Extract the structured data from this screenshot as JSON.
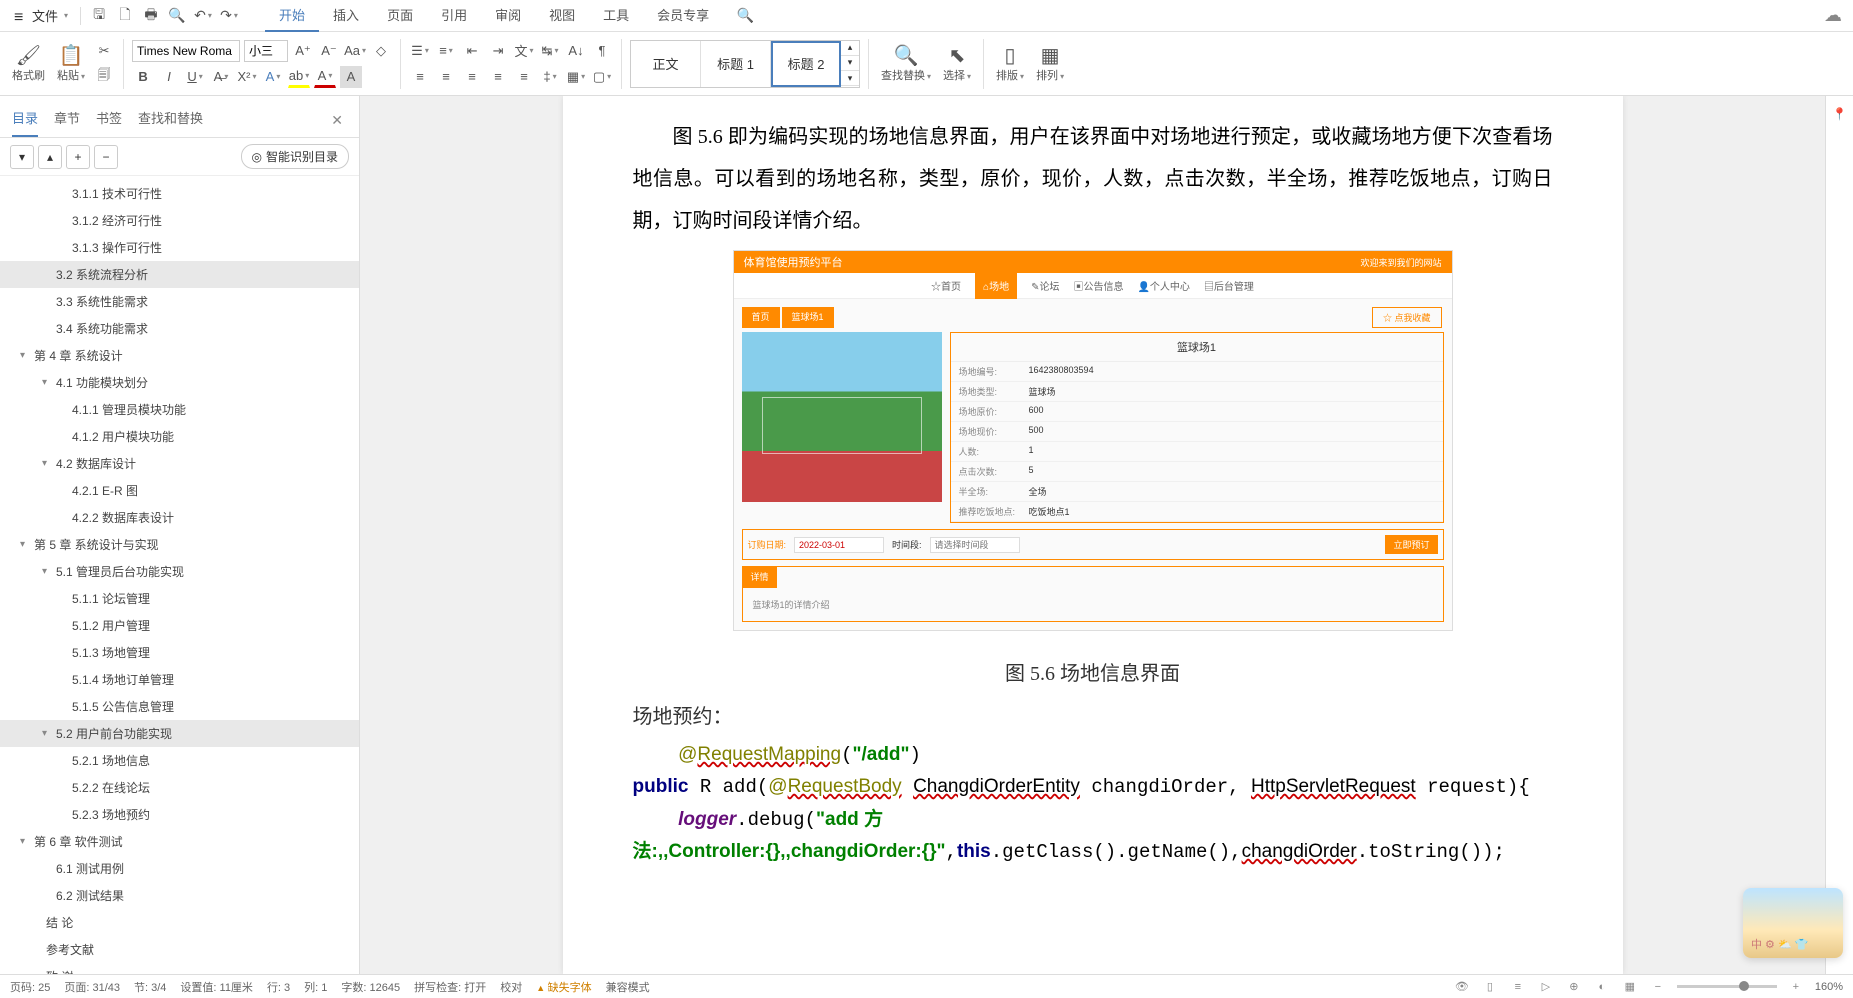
{
  "menubar": {
    "file": "文件",
    "tabs": [
      "开始",
      "插入",
      "页面",
      "引用",
      "审阅",
      "视图",
      "工具",
      "会员专享"
    ],
    "active_tab": 0
  },
  "ribbon": {
    "format_painter": "格式刷",
    "paste": "粘贴",
    "font_name": "Times New Roma",
    "font_size": "小三",
    "styles": {
      "normal": "正文",
      "h1": "标题 1",
      "h2": "标题 2"
    },
    "find_replace": "查找替换",
    "select": "选择",
    "layout": "排版",
    "arrange": "排列"
  },
  "sidebar": {
    "tabs": [
      "目录",
      "章节",
      "书签",
      "查找和替换"
    ],
    "active": 0,
    "smart_btn": "智能识别目录",
    "items": [
      {
        "lvl": 3,
        "txt": "3.1.1 技术可行性"
      },
      {
        "lvl": 3,
        "txt": "3.1.2 经济可行性"
      },
      {
        "lvl": 3,
        "txt": "3.1.3 操作可行性"
      },
      {
        "lvl": 2,
        "txt": "3.2 系统流程分析",
        "sel": true
      },
      {
        "lvl": 2,
        "txt": "3.3 系统性能需求"
      },
      {
        "lvl": 2,
        "txt": "3.4 系统功能需求"
      },
      {
        "lvl": 1,
        "txt": "第 4 章  系统设计",
        "caret": true
      },
      {
        "lvl": 2,
        "txt": "4.1 功能模块划分",
        "caret": true
      },
      {
        "lvl": 3,
        "txt": "4.1.1 管理员模块功能"
      },
      {
        "lvl": 3,
        "txt": "4.1.2 用户模块功能"
      },
      {
        "lvl": 2,
        "txt": "4.2 数据库设计",
        "caret": true
      },
      {
        "lvl": 3,
        "txt": "4.2.1 E-R 图"
      },
      {
        "lvl": 3,
        "txt": "4.2.2 数据库表设计"
      },
      {
        "lvl": 1,
        "txt": "第 5 章  系统设计与实现",
        "caret": true
      },
      {
        "lvl": 2,
        "txt": "5.1 管理员后台功能实现",
        "caret": true
      },
      {
        "lvl": 3,
        "txt": "5.1.1 论坛管理"
      },
      {
        "lvl": 3,
        "txt": "5.1.2 用户管理"
      },
      {
        "lvl": 3,
        "txt": "5.1.3 场地管理"
      },
      {
        "lvl": 3,
        "txt": "5.1.4 场地订单管理"
      },
      {
        "lvl": 3,
        "txt": "5.1.5 公告信息管理"
      },
      {
        "lvl": 2,
        "txt": "5.2 用户前台功能实现",
        "caret": true,
        "sel": true
      },
      {
        "lvl": 3,
        "txt": "5.2.1 场地信息"
      },
      {
        "lvl": 3,
        "txt": "5.2.2 在线论坛"
      },
      {
        "lvl": 3,
        "txt": "5.2.3 场地预约"
      },
      {
        "lvl": 1,
        "txt": "第 6 章  软件测试",
        "caret": true
      },
      {
        "lvl": 2,
        "txt": "6.1 测试用例"
      },
      {
        "lvl": 2,
        "txt": "6.2 测试结果"
      },
      {
        "lvl": 0,
        "txt": "结  论"
      },
      {
        "lvl": 0,
        "txt": "参考文献"
      },
      {
        "lvl": 0,
        "txt": "致  谢"
      }
    ]
  },
  "doc": {
    "p1": "图 5.6 即为编码实现的场地信息界面，用户在该界面中对场地进行预定，或收藏场地方便下次查看场地信息。可以看到的场地名称，类型，原价，现价，人数，点击次数，半全场，推荐吃饭地点，订购日期，订购时间段详情介绍。",
    "caption": "图 5.6  场地信息界面",
    "h": "场地预约：",
    "embed": {
      "header": "体育馆使用预约平台",
      "header_right": "欢迎来到我们的网站",
      "nav": [
        "☆首页",
        "⌂场地",
        "✎论坛",
        "▣公告信息",
        "👤个人中心",
        "▤后台管理"
      ],
      "crumb1": "首页",
      "crumb2": "篮球场1",
      "fav": "☆ 点我收藏",
      "title": "篮球场1",
      "fields": [
        {
          "k": "场地编号:",
          "v": "1642380803594"
        },
        {
          "k": "场地类型:",
          "v": "篮球场"
        },
        {
          "k": "场地原价:",
          "v": "600"
        },
        {
          "k": "场地现价:",
          "v": "500"
        },
        {
          "k": "人数:",
          "v": "1"
        },
        {
          "k": "点击次数:",
          "v": "5"
        },
        {
          "k": "半全场:",
          "v": "全场"
        },
        {
          "k": "推荐吃饭地点:",
          "v": "吃饭地点1"
        }
      ],
      "date_lbl": "订购日期:",
      "date_val": "2022-03-01",
      "time_lbl": "时间段:",
      "time_ph": "请选择时间段",
      "buy_btn": "立即预订",
      "detail_tab": "详情",
      "detail_txt": "篮球场1的详情介绍"
    }
  },
  "status": {
    "page_no": "页码: 25",
    "pages": "页面: 31/43",
    "section": "节: 3/4",
    "setval": "设置值: 11厘米",
    "row": "行: 3",
    "col": "列: 1",
    "words": "字数: 12645",
    "spell": "拼写检查: 打开",
    "proof": "校对",
    "missing_font": "缺失字体",
    "compat": "兼容模式",
    "zoom": "160%"
  }
}
